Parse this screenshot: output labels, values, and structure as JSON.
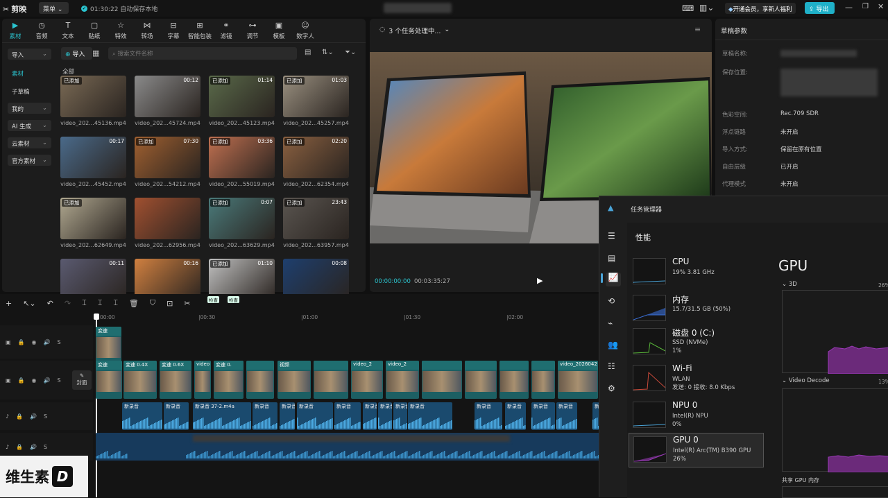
{
  "app": {
    "name": "剪映",
    "menu_label": "菜单",
    "autosave": "01:30:22 自动保存本地",
    "member_label": "开通会员，享新人福利",
    "export_label": "导出"
  },
  "tools": [
    {
      "label": "素材",
      "icon": "material-icon"
    },
    {
      "label": "音频",
      "icon": "audio-icon"
    },
    {
      "label": "文本",
      "icon": "text-icon"
    },
    {
      "label": "贴纸",
      "icon": "sticker-icon"
    },
    {
      "label": "特效",
      "icon": "effects-icon"
    },
    {
      "label": "转场",
      "icon": "transition-icon"
    },
    {
      "label": "字幕",
      "icon": "subtitle-icon"
    },
    {
      "label": "智能包装",
      "icon": "smart-pack-icon"
    },
    {
      "label": "滤镜",
      "icon": "filter-icon"
    },
    {
      "label": "调节",
      "icon": "adjust-icon"
    },
    {
      "label": "模板",
      "icon": "template-icon"
    },
    {
      "label": "数字人",
      "icon": "avatar-icon"
    }
  ],
  "sidebar": [
    {
      "label": "导入",
      "dropdown": true
    },
    {
      "label": "素材",
      "dropdown": false
    },
    {
      "label": "子草稿",
      "dropdown": false
    },
    {
      "label": "我的",
      "dropdown": true
    },
    {
      "label": "AI 生成",
      "dropdown": true
    },
    {
      "label": "云素材",
      "dropdown": true
    },
    {
      "label": "官方素材",
      "dropdown": true
    }
  ],
  "media": {
    "import_label": "导入",
    "search_placeholder": "搜索文件名称",
    "section_label": "全部",
    "items": [
      {
        "name": "video_202...45136.mp4",
        "badge": "已添加",
        "duration": ""
      },
      {
        "name": "video_202...45724.mp4",
        "badge": "",
        "duration": "00:12"
      },
      {
        "name": "video_202...45123.mp4",
        "badge": "已添加",
        "duration": "01:14"
      },
      {
        "name": "video_202...45257.mp4",
        "badge": "已添加",
        "duration": "01:03"
      },
      {
        "name": "video_202...45452.mp4",
        "badge": "",
        "duration": "00:17"
      },
      {
        "name": "video_202...54212.mp4",
        "badge": "已添加",
        "duration": "07:30"
      },
      {
        "name": "video_202...55019.mp4",
        "badge": "已添加",
        "duration": "03:36"
      },
      {
        "name": "video_202...62354.mp4",
        "badge": "已添加",
        "duration": "02:20"
      },
      {
        "name": "video_202...62649.mp4",
        "badge": "已添加",
        "duration": ""
      },
      {
        "name": "video_202...62956.mp4",
        "badge": "",
        "duration": ""
      },
      {
        "name": "video_202...63629.mp4",
        "badge": "已添加",
        "duration": "0:07"
      },
      {
        "name": "video_202...63957.mp4",
        "badge": "已添加",
        "duration": "23:43"
      },
      {
        "name": "",
        "badge": "",
        "duration": "00:11"
      },
      {
        "name": "",
        "badge": "",
        "duration": "00:16"
      },
      {
        "name": "",
        "badge": "已添加",
        "duration": "01:10"
      },
      {
        "name": "",
        "badge": "",
        "duration": "00:08"
      }
    ]
  },
  "player": {
    "status": "3 个任务处理中...",
    "current_time": "00:00:00:00",
    "total_time": "00:03:35:27"
  },
  "draft": {
    "title": "草稿参数",
    "rows": [
      {
        "label": "草稿名称:",
        "value": ""
      },
      {
        "label": "保存位置:",
        "value": ""
      },
      {
        "label": "色彩空间:",
        "value": "Rec.709 SDR"
      },
      {
        "label": "浮点链路",
        "value": "未开启"
      },
      {
        "label": "导入方式:",
        "value": "保留在原有位置"
      },
      {
        "label": "自由层级",
        "value": "已开启"
      },
      {
        "label": "代理模式",
        "value": "未开启"
      }
    ]
  },
  "timeline": {
    "ticks": [
      "00:00",
      "|00:30",
      "|01:00",
      "|01:30",
      "|02:00"
    ],
    "cover_label": "封面",
    "track_labels": {
      "track_s": "S"
    },
    "audio_clip_label": "新录音 37-2.m4a",
    "audio_clip_short": "新录音",
    "video_clip_labels": [
      "变速",
      "变速 0.4X",
      "变速 0.6X",
      "video",
      "变速 0.",
      "视频",
      "video_2",
      "video_2026042"
    ],
    "tag1": "检查",
    "tag2": "检查"
  },
  "taskmgr": {
    "title": "任务管理器",
    "section": "性能",
    "gpu_header": "GPU",
    "engine_3d": "3D",
    "engine_3d_pct": "26%",
    "engine_decode": "Video Decode",
    "engine_decode_pct": "13%",
    "shared_mem": "共享 GPU 内存",
    "items": [
      {
        "name": "CPU",
        "sub1": "19%  3.81 GHz",
        "sub2": "",
        "color": "#4aa4d8"
      },
      {
        "name": "内存",
        "sub1": "15.7/31.5 GB (50%)",
        "sub2": "",
        "color": "#3a6fd8"
      },
      {
        "name": "磁盘 0 (C:)",
        "sub1": "SSD (NVMe)",
        "sub2": "1%",
        "color": "#5ab83a"
      },
      {
        "name": "Wi-Fi",
        "sub1": "WLAN",
        "sub2": "发送: 0 接收: 8.0 Kbps",
        "color": "#c84a3a"
      },
      {
        "name": "NPU 0",
        "sub1": "Intel(R) NPU",
        "sub2": "0%",
        "color": "#4aa4d8"
      },
      {
        "name": "GPU 0",
        "sub1": "Intel(R) Arc(TM) B390 GPU",
        "sub2": "26%",
        "color": "#9a3ab8"
      }
    ]
  },
  "watermark": "维生素"
}
